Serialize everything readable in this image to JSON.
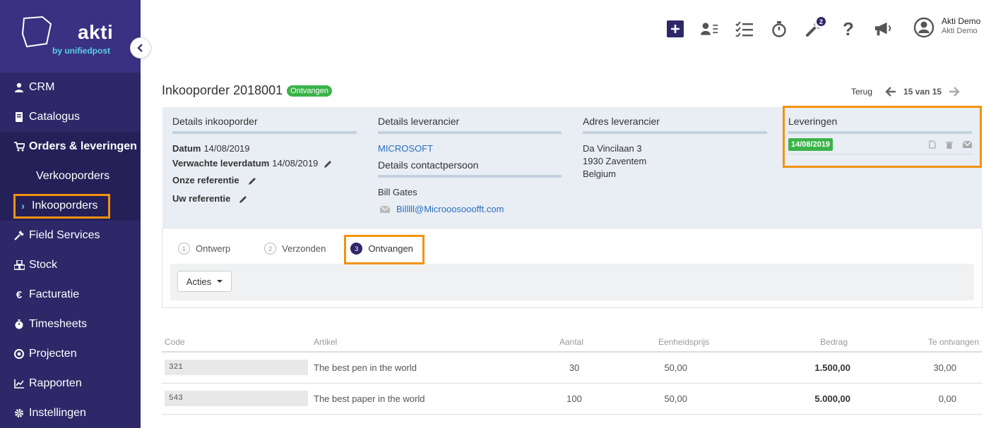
{
  "brand": {
    "name": "akti",
    "sub": "by unifiedpost"
  },
  "sidebar": {
    "items": [
      {
        "label": "CRM",
        "icon": "user-icon"
      },
      {
        "label": "Catalogus",
        "icon": "book-icon"
      },
      {
        "label": "Orders & leveringen",
        "icon": "cart-icon"
      },
      {
        "label": "Verkooporders"
      },
      {
        "label": "Inkooporders"
      },
      {
        "label": "Field Services",
        "icon": "wrench-icon"
      },
      {
        "label": "Stock",
        "icon": "cubes-icon"
      },
      {
        "label": "Facturatie",
        "icon": "euro-icon"
      },
      {
        "label": "Timesheets",
        "icon": "stopwatch-icon"
      },
      {
        "label": "Projecten",
        "icon": "target-icon"
      },
      {
        "label": "Rapporten",
        "icon": "chart-icon"
      },
      {
        "label": "Instellingen",
        "icon": "gear-icon"
      }
    ]
  },
  "topbar": {
    "badge_count": "2"
  },
  "user": {
    "name": "Akti Demo",
    "company": "Akti Demo"
  },
  "page": {
    "title": "Inkooporder 2018001",
    "status": "Ontvangen",
    "back": "Terug",
    "pager": "15 van 15"
  },
  "details": {
    "title": "Details inkooporder",
    "datum_label": "Datum",
    "datum": "14/08/2019",
    "leverdatum_label": "Verwachte leverdatum",
    "leverdatum": "14/08/2019",
    "onze_ref": "Onze referentie",
    "uw_ref": "Uw referentie"
  },
  "supplier": {
    "title": "Details leverancier",
    "name": "MICROSOFT",
    "contact_title": "Details contactpersoon",
    "contact_name": "Bill Gates",
    "contact_email": "Billlll@Microoosooofft.com"
  },
  "address": {
    "title": "Adres leverancier",
    "line1": "Da Vincilaan 3",
    "line2": "1930 Zaventem",
    "line3": "Belgium"
  },
  "deliveries": {
    "title": "Leveringen",
    "date": "14/08/2019"
  },
  "steps": [
    {
      "num": "1",
      "label": "Ontwerp"
    },
    {
      "num": "2",
      "label": "Verzonden"
    },
    {
      "num": "3",
      "label": "Ontvangen"
    }
  ],
  "actions_label": "Acties",
  "table": {
    "headers": [
      "Code",
      "Artikel",
      "Aantal",
      "Eenheidsprijs",
      "Bedrag",
      "Te ontvangen"
    ],
    "rows": [
      {
        "code": "321",
        "artikel": "The best pen in the world",
        "aantal": "30",
        "prijs": "50,00",
        "bedrag": "1.500,00",
        "te_ontvangen": "30,00"
      },
      {
        "code": "543",
        "artikel": "The best paper in the world",
        "aantal": "100",
        "prijs": "50,00",
        "bedrag": "5.000,00",
        "te_ontvangen": "0,00"
      }
    ]
  },
  "colors": {
    "sidebar": "#2e2768",
    "accent": "#5bd0e6",
    "highlight": "#f2930d",
    "success": "#3bb34a",
    "link": "#2a6ebf"
  }
}
